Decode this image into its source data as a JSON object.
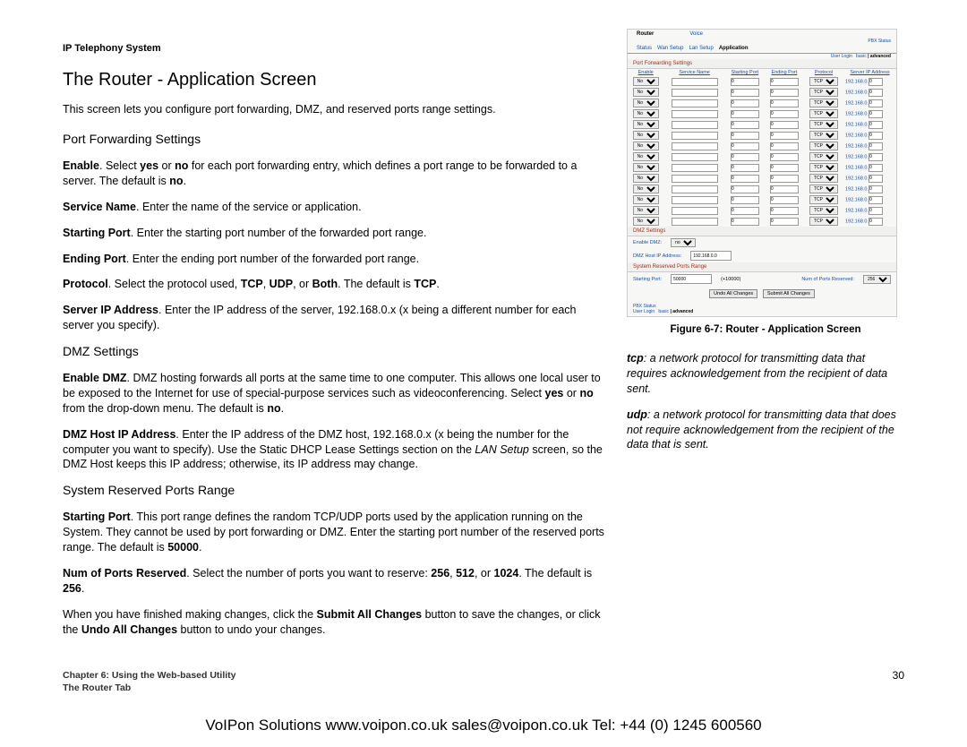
{
  "header": "IP Telephony System",
  "title": "The Router - Application Screen",
  "intro": "This screen lets you configure port forwarding, DMZ, and reserved ports range settings.",
  "sections": {
    "pf": {
      "heading": "Port Forwarding Settings",
      "enable_pre": "Enable",
      "enable_mid1": ". Select ",
      "enable_yes": "yes",
      "enable_mid2": " or ",
      "enable_no": "no",
      "enable_post": " for each port forwarding entry, which defines a port range to be forwarded to a server. The default is ",
      "enable_def": "no",
      "svc_pre": "Service Name",
      "svc_post": ". Enter the name of the service or application.",
      "sp_pre": "Starting Port",
      "sp_post": ". Enter the starting port number of the forwarded port range.",
      "ep_pre": "Ending Port",
      "ep_post": ". Enter the ending port number of the forwarded port range.",
      "proto_pre": "Protocol",
      "proto_mid": ". Select the protocol used, ",
      "proto_tcp": "TCP",
      "proto_c1": ", ",
      "proto_udp": "UDP",
      "proto_c2": ", or ",
      "proto_both": "Both",
      "proto_post": ". The default is ",
      "proto_def": "TCP",
      "ip_pre": "Server IP Address",
      "ip_post": ". Enter the IP address of the server, 192.168.0.x (x being a different number for each server you specify)."
    },
    "dmz": {
      "heading": "DMZ Settings",
      "en_pre": "Enable DMZ",
      "en_mid1": ". DMZ hosting forwards all ports at the same time to one computer. This allows one local user to be exposed to the Internet for use of special-purpose services such as videoconferencing. Select ",
      "en_yes": "yes",
      "en_mid2": " or ",
      "en_no": "no",
      "en_mid3": " from the drop-down menu. The default is ",
      "en_def": "no",
      "host_pre": "DMZ Host IP Address",
      "host_mid": ". Enter the IP address of the DMZ host, 192.168.0.x (x being the number for the computer you want to specify). Use the Static DHCP Lease Settings section on the ",
      "host_screen": "LAN Setup",
      "host_post": " screen, so the DMZ Host keeps this IP address; otherwise, its IP address may change."
    },
    "sys": {
      "heading": "System Reserved Ports Range",
      "sp_pre": "Starting Port",
      "sp_post": ". This port range defines the random TCP/UDP ports used by the application running on the System. They cannot be used by port forwarding or DMZ. Enter the starting port number of the reserved ports range. The default is ",
      "sp_def": "50000",
      "num_pre": "Num of Ports Reserved",
      "num_mid": ". Select the number of ports you want to reserve: ",
      "num_256": "256",
      "num_c1": ", ",
      "num_512": "512",
      "num_c2": ", or ",
      "num_1024": "1024",
      "num_post": ". The default is ",
      "num_def": "256"
    },
    "final": {
      "pre": "When you have finished making changes, click the ",
      "submit": "Submit All Changes",
      "mid": " button to save the changes, or click the ",
      "undo": "Undo All Changes",
      "post": " button to undo your changes."
    }
  },
  "figure": {
    "caption": "Figure 6-7: Router - Application Screen",
    "tabs": {
      "router": "Router",
      "voice": "Voice"
    },
    "subtabs": {
      "status": "Status",
      "wan": "Wan Setup",
      "lan": "Lan Setup",
      "app": "Application"
    },
    "toplink": "PBX Status",
    "viewline": {
      "user": "User Login",
      "basic": "basic",
      "pipe": "|",
      "adv": "advanced"
    },
    "pfs_title": "Port Forwarding Settings",
    "cols": {
      "enable": "Enable",
      "service": "Service Name",
      "start": "Starting Port",
      "end": "Ending Port",
      "proto": "Protocol",
      "ip": "Server IP Address"
    },
    "row": {
      "enable": "No",
      "start": "0",
      "end": "0",
      "proto": "TCP",
      "ip": "192.168.0.",
      "ip_end": "0"
    },
    "dmz_title": "DMZ Settings",
    "dmz_enable": "Enable DMZ:",
    "dmz_enable_val": "no",
    "dmz_host": "DMZ Host IP Address:",
    "dmz_host_val": "192.168.0.0",
    "sys_title": "System Reserved Ports Range",
    "sys_start": "Starting Port:",
    "sys_start_val": "50000",
    "sys_start_hint": "(+10000)",
    "sys_num": "Num of Ports Reserved:",
    "sys_num_val": "256",
    "btn_undo": "Undo All Changes",
    "btn_submit": "Submit All Changes"
  },
  "definitions": {
    "tcp_b": "tcp",
    "tcp": ": a network protocol for transmitting data that requires acknowledgement from the recipient of data sent.",
    "udp_b": "udp",
    "udp": ": a network protocol for transmitting data that does not require acknowledgement from the recipient of the data that is sent."
  },
  "footer": {
    "chapter": "Chapter 6: Using the Web-based Utility",
    "section": "The Router Tab",
    "page": "30"
  },
  "bottom": "VoIPon Solutions  www.voipon.co.uk  sales@voipon.co.uk  Tel: +44 (0) 1245 600560"
}
